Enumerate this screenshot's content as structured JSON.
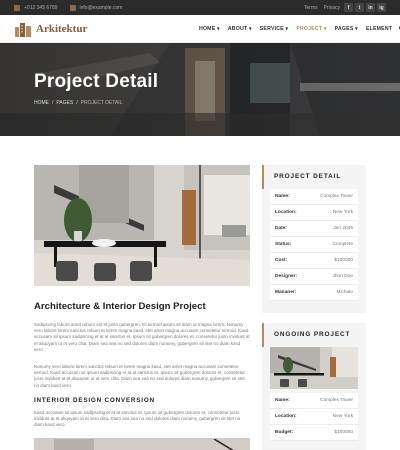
{
  "topbar": {
    "phone": "+012 345 6789",
    "email": "info@example.com",
    "links": [
      "Terms",
      "Privacy"
    ],
    "social": [
      "f",
      "t",
      "in",
      "ig"
    ]
  },
  "brand": {
    "name": "Arkitektur"
  },
  "nav": {
    "items": [
      {
        "label": "HOME",
        "caret": "▾",
        "active": false
      },
      {
        "label": "ABOUT",
        "caret": "▾",
        "active": false
      },
      {
        "label": "SERVICE",
        "caret": "▾",
        "active": false
      },
      {
        "label": "PROJECT",
        "caret": "▾",
        "active": true
      },
      {
        "label": "PAGES",
        "caret": "▾",
        "active": false
      },
      {
        "label": "ELEMENT",
        "caret": "",
        "active": false
      }
    ],
    "search_icon": "search-icon",
    "menu_icon": "hamburger-menu-icon"
  },
  "hero": {
    "title": "Project Detail",
    "breadcrumb": [
      "HOME",
      "/",
      "PAGES",
      "/",
      "PROJECT DETAIL"
    ]
  },
  "article": {
    "title": "Architecture & Interior Design Project",
    "paragraphs": [
      "Sadipscing labore amet rebum est et justo gubergren. Et eirmod ipsum sit diam ut magna lorem. Nonumy vero labore lorem sanctus rebum et lorem magna kasd, stet amet magna accusam consetetur eirmod. Kasd accusam sit ipsum sadipscing et at at sanctus et. Ipsum sit gubergren dolores et, consetetur justo invidunt at et aliquyam ut et vero clita. Diam sea sea no sed dolores diam nonumy, gubergren sit stet no diam kasd vero.",
      "Nonumy vero labore lorem sanctus rebum et lorem magna kasd, stet amet magna accusam consetetur eirmod. Kasd accusam sit ipsum sadipscing et at at sanctus et. Ipsum sit gubergren dolores et, consetetur justo invidunt at et aliquyam ut et vero clita. Diam sea sea no sed dolores diam nonumy, gubergren sit stet no diam kasd vero.",
      "Kasd accusam sit ipsum sadipscing et at at sanctus et. Ipsum sit gubergren dolores et, consetetur justo invidunt at et aliquyam ut et vero clita. Diam sea sea no sed dolores diam nonumy, gubergren sit stet no diam kasd vero."
    ],
    "subheading": "INTERIOR DESIGN CONVERSION"
  },
  "project_detail": {
    "heading": "PROJECT DETAIL",
    "rows": [
      {
        "key": "Name:",
        "value": "Complex Tower"
      },
      {
        "key": "Location:",
        "value": "New York"
      },
      {
        "key": "Date:",
        "value": "Jan 2045"
      },
      {
        "key": "Status:",
        "value": "Complete"
      },
      {
        "key": "Cost:",
        "value": "$100000"
      },
      {
        "key": "Designer:",
        "value": "Jhon Doe"
      },
      {
        "key": "Mananer:",
        "value": "Michale"
      }
    ]
  },
  "ongoing_project": {
    "heading": "ONGOING PROJECT",
    "rows": [
      {
        "key": "Name:",
        "value": "Complex Tower"
      },
      {
        "key": "Location:",
        "value": "New York"
      },
      {
        "key": "Budget:",
        "value": "$100000"
      }
    ]
  },
  "colors": {
    "accent": "#b78b5e",
    "brand": "#8a5a3a",
    "topbar": "#2b2b2b",
    "sidebar_bg": "#f4f4f4"
  }
}
